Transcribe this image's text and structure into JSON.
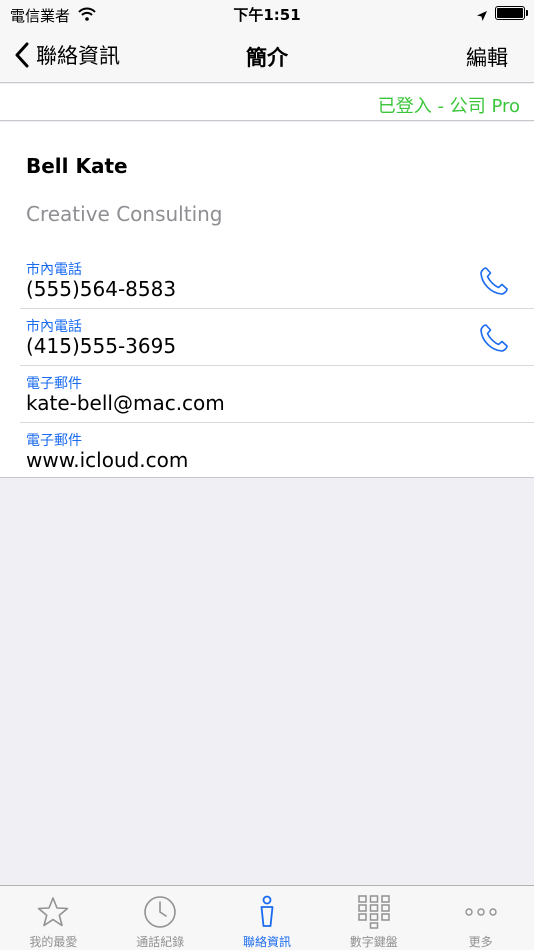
{
  "status_bar": {
    "carrier": "電信業者",
    "time": "下午1:51"
  },
  "nav": {
    "back_label": "聯絡資訊",
    "title": "簡介",
    "edit_label": "編輯"
  },
  "login_status": "已登入 - 公司 Pro",
  "contact": {
    "name": "Bell Kate",
    "company": "Creative Consulting",
    "fields": [
      {
        "label": "市內電話",
        "value": "(555)564-8583",
        "icon": "phone-icon"
      },
      {
        "label": "市內電話",
        "value": "(415)555-3695",
        "icon": "phone-icon"
      },
      {
        "label": "電子郵件",
        "value": "kate-bell@mac.com"
      },
      {
        "label": "電子郵件",
        "value": "www.icloud.com"
      }
    ]
  },
  "tabs": [
    {
      "label": "我的最愛",
      "icon": "star-icon",
      "active": false
    },
    {
      "label": "通話紀錄",
      "icon": "clock-icon",
      "active": false
    },
    {
      "label": "聯絡資訊",
      "icon": "person-icon",
      "active": true
    },
    {
      "label": "數字鍵盤",
      "icon": "keypad-icon",
      "active": false
    },
    {
      "label": "更多",
      "icon": "more-icon",
      "active": false
    }
  ],
  "colors": {
    "accent": "#1a6bf0",
    "login_green": "#3ac63a",
    "background": "#efeff4",
    "tab_inactive": "#929292"
  }
}
